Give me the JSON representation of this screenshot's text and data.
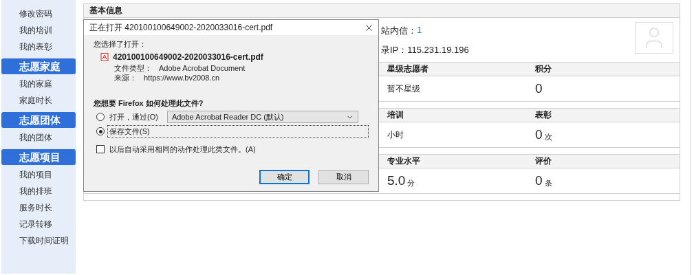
{
  "sidebar": [
    {
      "kind": "item",
      "label": "修改密码"
    },
    {
      "kind": "item",
      "label": "我的培训"
    },
    {
      "kind": "item",
      "label": "我的表彰"
    },
    {
      "kind": "header",
      "label": "志愿家庭"
    },
    {
      "kind": "item",
      "label": "我的家庭"
    },
    {
      "kind": "item",
      "label": "家庭时长"
    },
    {
      "kind": "header",
      "label": "志愿团体"
    },
    {
      "kind": "item",
      "label": "我的团体"
    },
    {
      "kind": "header",
      "label": "志愿项目"
    },
    {
      "kind": "item",
      "label": "我的项目"
    },
    {
      "kind": "item",
      "label": "我的排班"
    },
    {
      "kind": "item",
      "label": "服务时长"
    },
    {
      "kind": "item",
      "label": "记录转移"
    },
    {
      "kind": "item",
      "label": "下载时间证明"
    }
  ],
  "section_title": "基本信息",
  "info": {
    "messages_label": "站内信：",
    "messages_count": "1",
    "ip": "录IP：115.231.19.196"
  },
  "stat_tables": [
    {
      "columns": [
        "星级志愿者",
        "积分"
      ],
      "cells": [
        {
          "kind": "text",
          "value": "暂不星级"
        },
        {
          "kind": "big",
          "value": "0"
        }
      ]
    },
    {
      "columns": [
        "培训",
        "表彰"
      ],
      "cells": [
        {
          "kind": "text",
          "value": "小时"
        },
        {
          "kind": "big",
          "value": "0",
          "unit": "次"
        }
      ]
    },
    {
      "columns": [
        "专业水平",
        "评价"
      ],
      "cells": [
        {
          "kind": "big",
          "value": "5.0",
          "unit": "分"
        },
        {
          "kind": "big",
          "value": "0",
          "unit": "条"
        }
      ]
    }
  ],
  "dialog": {
    "title": "正在打开 420100100649002-2020033016-cert.pdf",
    "chosen_label": "您选择了打开：",
    "file_name": "420100100649002-2020033016-cert.pdf",
    "type_label": "文件类型：",
    "type_value": "Adobe Acrobat Document",
    "source_label": "来源：",
    "source_value": "https://www.bv2008.cn",
    "question": "您想要 Firefox 如何处理此文件?",
    "options": [
      {
        "label": "打开，通过(O)",
        "selected": false,
        "app": "Adobe Acrobat Reader DC (默认)"
      },
      {
        "label": "保存文件(S)",
        "selected": true
      }
    ],
    "remember": {
      "label": "以后自动采用相同的动作处理此类文件。(A)",
      "checked": false
    },
    "buttons": [
      {
        "label": "确定",
        "default": true
      },
      {
        "label": "取消",
        "default": false
      }
    ]
  }
}
